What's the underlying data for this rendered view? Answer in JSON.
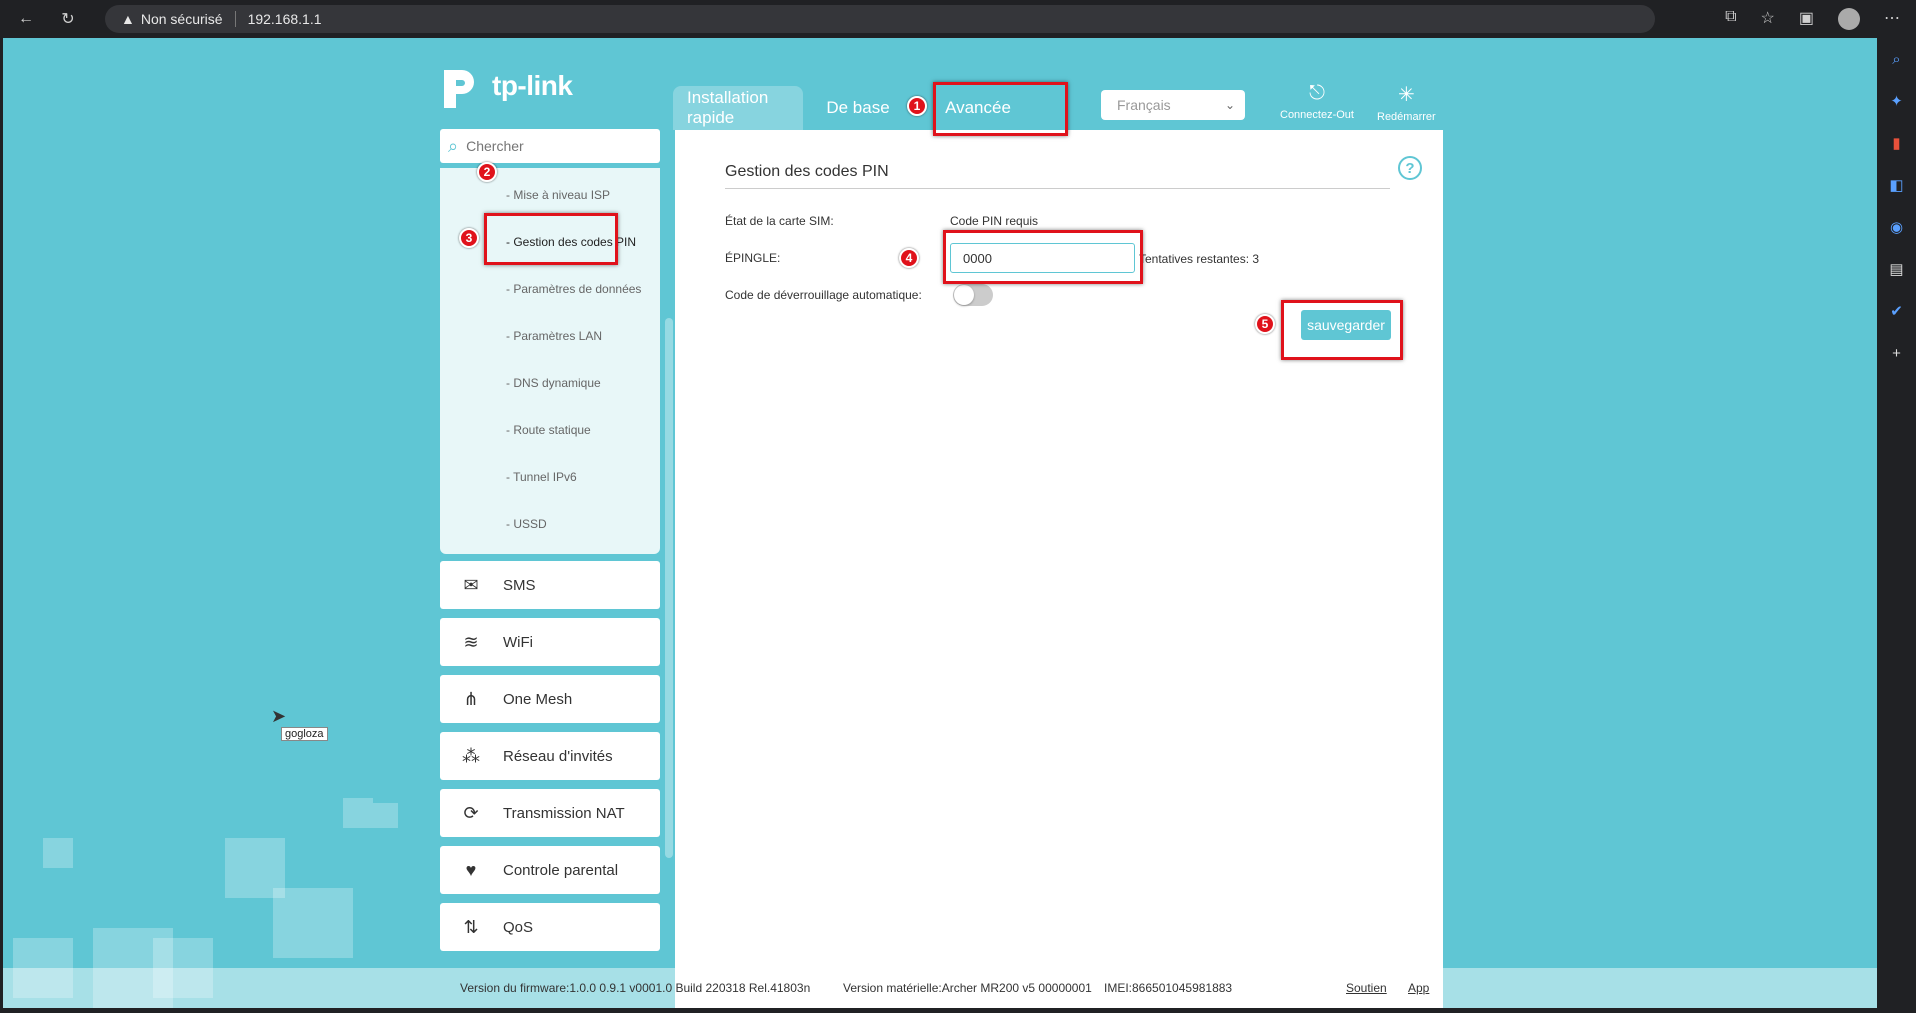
{
  "browser": {
    "security_label": "Non sécurisé",
    "url": "192.168.1.1"
  },
  "brand": {
    "logo_text": "tp-link"
  },
  "nav": {
    "tabs": [
      {
        "label": "Installation rapide"
      },
      {
        "label": "De base"
      },
      {
        "label": "Avancée"
      }
    ],
    "language": "Français",
    "logout_label": "Connectez-Out",
    "reboot_label": "Redémarrer"
  },
  "sidebar": {
    "search_placeholder": "Chercher",
    "sub_items": [
      {
        "label": "- Mise à niveau ISP"
      },
      {
        "label": "- Gestion des codes PIN"
      },
      {
        "label": "- Paramètres de données"
      },
      {
        "label": "- Paramètres LAN"
      },
      {
        "label": "- DNS dynamique"
      },
      {
        "label": "- Route statique"
      },
      {
        "label": "- Tunnel IPv6"
      },
      {
        "label": "- USSD"
      }
    ],
    "menu": [
      {
        "label": "SMS",
        "icon": "envelope-icon"
      },
      {
        "label": "WiFi",
        "icon": "wifi-icon"
      },
      {
        "label": "One Mesh",
        "icon": "mesh-icon"
      },
      {
        "label": "Réseau d'invités",
        "icon": "guests-icon"
      },
      {
        "label": "Transmission NAT",
        "icon": "nat-icon"
      },
      {
        "label": "Controle parental",
        "icon": "heart-icon"
      },
      {
        "label": "QoS",
        "icon": "qos-icon"
      }
    ]
  },
  "main": {
    "title": "Gestion des codes PIN",
    "sim_state_label": "État de la carte SIM:",
    "sim_state_value": "Code PIN requis",
    "pin_label": "ÉPINGLE:",
    "pin_value": "0000",
    "tries_label": "Tentatives restantes: 3",
    "auto_unlock_label": "Code de déverrouillage automatique:",
    "auto_unlock_on": false,
    "save_label": "sauvegarder"
  },
  "footer": {
    "firmware": "Version du firmware:1.0.0 0.9.1 v0001.0 Build 220318 Rel.41803n",
    "hardware": "Version matérielle:Archer MR200 v5 00000001",
    "imei": "IMEI:866501045981883",
    "support": "Soutien",
    "app": "App"
  },
  "annotations": [
    "1",
    "2",
    "3",
    "4",
    "5"
  ],
  "cursor_tooltip": "gogloza",
  "colors": {
    "accent": "#5fc6d4",
    "highlight": "#e0121b"
  }
}
